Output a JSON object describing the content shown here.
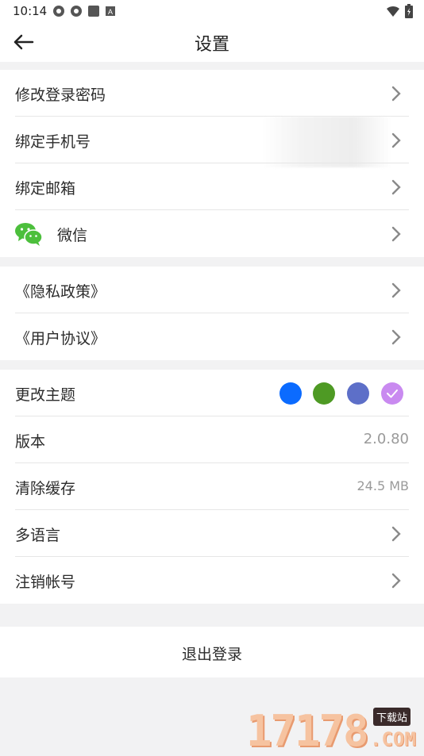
{
  "status_bar": {
    "time": "10:14",
    "icons": [
      "settings-app-icon",
      "settings-app-icon",
      "square-icon",
      "a-icon"
    ],
    "right_icons": [
      "wifi-icon",
      "battery-icon"
    ]
  },
  "header": {
    "title": "设置",
    "back_icon": "arrow-left-icon"
  },
  "account_section": [
    {
      "label": "修改登录密码",
      "type": "nav"
    },
    {
      "label": "绑定手机号",
      "type": "nav"
    },
    {
      "label": "绑定邮箱",
      "type": "nav"
    },
    {
      "label": "微信",
      "type": "nav",
      "icon": "wechat-icon"
    }
  ],
  "policy_section": [
    {
      "label": "《隐私政策》",
      "type": "nav"
    },
    {
      "label": "《用户协议》",
      "type": "nav"
    }
  ],
  "general_section": {
    "theme": {
      "label": "更改主题",
      "colors": [
        "#0b6bff",
        "#4e9a24",
        "#5d6fc8",
        "#c98af0"
      ],
      "selected_index": 3
    },
    "version": {
      "label": "版本",
      "value": "2.0.80"
    },
    "cache": {
      "label": "清除缓存",
      "value": "24.5 MB"
    },
    "language": {
      "label": "多语言"
    },
    "deactivate": {
      "label": "注销帐号"
    }
  },
  "logout": {
    "label": "退出登录"
  },
  "watermark": {
    "digits": "17178",
    "tag": "下载站",
    "suffix": ".COM"
  },
  "colors": {
    "background": "#f2f2f3",
    "card": "#ffffff",
    "divider": "#e6e6e6",
    "chevron": "#8a8a8a",
    "muted_text": "#9a9a9a"
  }
}
